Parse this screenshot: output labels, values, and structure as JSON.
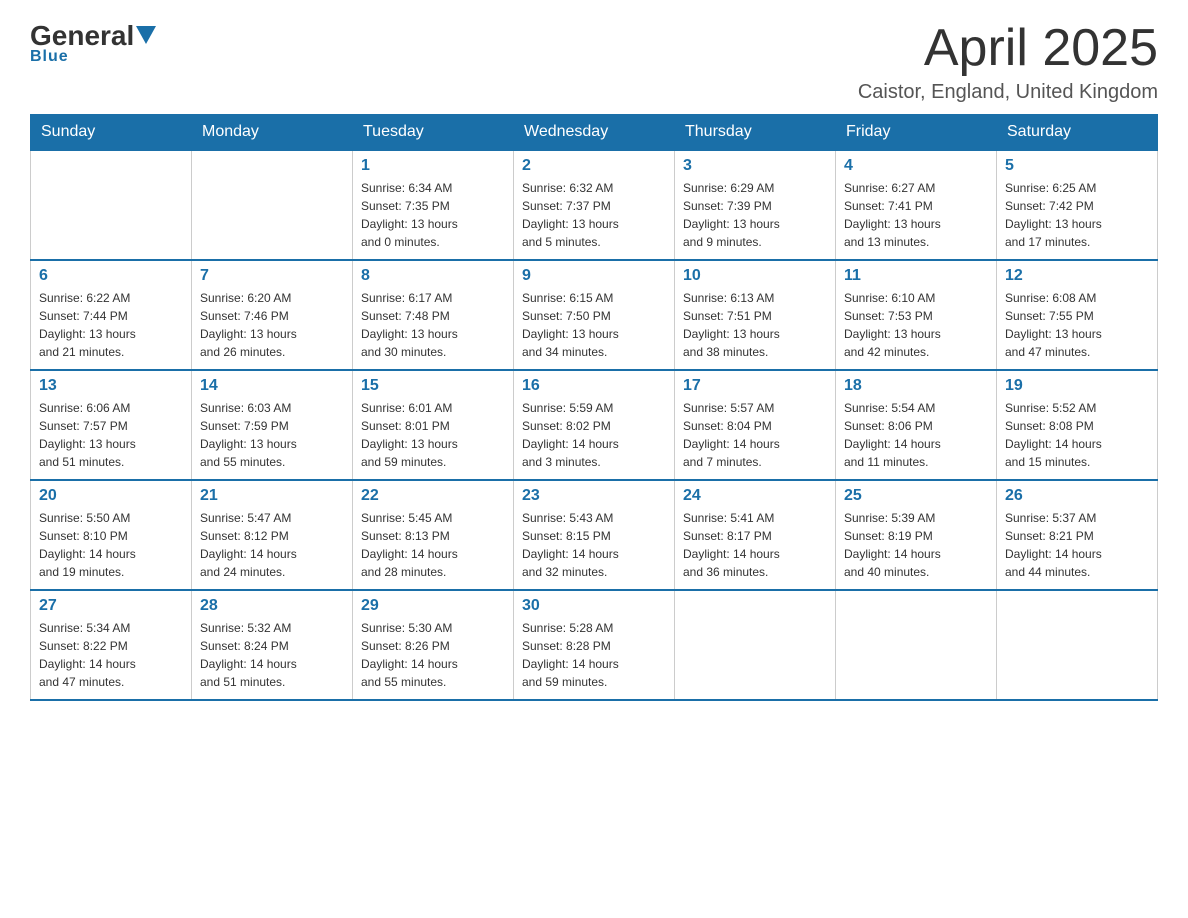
{
  "logo": {
    "general": "General",
    "blue": "Blue"
  },
  "header": {
    "title": "April 2025",
    "subtitle": "Caistor, England, United Kingdom"
  },
  "weekdays": [
    "Sunday",
    "Monday",
    "Tuesday",
    "Wednesday",
    "Thursday",
    "Friday",
    "Saturday"
  ],
  "weeks": [
    [
      {
        "day": "",
        "info": ""
      },
      {
        "day": "",
        "info": ""
      },
      {
        "day": "1",
        "info": "Sunrise: 6:34 AM\nSunset: 7:35 PM\nDaylight: 13 hours\nand 0 minutes."
      },
      {
        "day": "2",
        "info": "Sunrise: 6:32 AM\nSunset: 7:37 PM\nDaylight: 13 hours\nand 5 minutes."
      },
      {
        "day": "3",
        "info": "Sunrise: 6:29 AM\nSunset: 7:39 PM\nDaylight: 13 hours\nand 9 minutes."
      },
      {
        "day": "4",
        "info": "Sunrise: 6:27 AM\nSunset: 7:41 PM\nDaylight: 13 hours\nand 13 minutes."
      },
      {
        "day": "5",
        "info": "Sunrise: 6:25 AM\nSunset: 7:42 PM\nDaylight: 13 hours\nand 17 minutes."
      }
    ],
    [
      {
        "day": "6",
        "info": "Sunrise: 6:22 AM\nSunset: 7:44 PM\nDaylight: 13 hours\nand 21 minutes."
      },
      {
        "day": "7",
        "info": "Sunrise: 6:20 AM\nSunset: 7:46 PM\nDaylight: 13 hours\nand 26 minutes."
      },
      {
        "day": "8",
        "info": "Sunrise: 6:17 AM\nSunset: 7:48 PM\nDaylight: 13 hours\nand 30 minutes."
      },
      {
        "day": "9",
        "info": "Sunrise: 6:15 AM\nSunset: 7:50 PM\nDaylight: 13 hours\nand 34 minutes."
      },
      {
        "day": "10",
        "info": "Sunrise: 6:13 AM\nSunset: 7:51 PM\nDaylight: 13 hours\nand 38 minutes."
      },
      {
        "day": "11",
        "info": "Sunrise: 6:10 AM\nSunset: 7:53 PM\nDaylight: 13 hours\nand 42 minutes."
      },
      {
        "day": "12",
        "info": "Sunrise: 6:08 AM\nSunset: 7:55 PM\nDaylight: 13 hours\nand 47 minutes."
      }
    ],
    [
      {
        "day": "13",
        "info": "Sunrise: 6:06 AM\nSunset: 7:57 PM\nDaylight: 13 hours\nand 51 minutes."
      },
      {
        "day": "14",
        "info": "Sunrise: 6:03 AM\nSunset: 7:59 PM\nDaylight: 13 hours\nand 55 minutes."
      },
      {
        "day": "15",
        "info": "Sunrise: 6:01 AM\nSunset: 8:01 PM\nDaylight: 13 hours\nand 59 minutes."
      },
      {
        "day": "16",
        "info": "Sunrise: 5:59 AM\nSunset: 8:02 PM\nDaylight: 14 hours\nand 3 minutes."
      },
      {
        "day": "17",
        "info": "Sunrise: 5:57 AM\nSunset: 8:04 PM\nDaylight: 14 hours\nand 7 minutes."
      },
      {
        "day": "18",
        "info": "Sunrise: 5:54 AM\nSunset: 8:06 PM\nDaylight: 14 hours\nand 11 minutes."
      },
      {
        "day": "19",
        "info": "Sunrise: 5:52 AM\nSunset: 8:08 PM\nDaylight: 14 hours\nand 15 minutes."
      }
    ],
    [
      {
        "day": "20",
        "info": "Sunrise: 5:50 AM\nSunset: 8:10 PM\nDaylight: 14 hours\nand 19 minutes."
      },
      {
        "day": "21",
        "info": "Sunrise: 5:47 AM\nSunset: 8:12 PM\nDaylight: 14 hours\nand 24 minutes."
      },
      {
        "day": "22",
        "info": "Sunrise: 5:45 AM\nSunset: 8:13 PM\nDaylight: 14 hours\nand 28 minutes."
      },
      {
        "day": "23",
        "info": "Sunrise: 5:43 AM\nSunset: 8:15 PM\nDaylight: 14 hours\nand 32 minutes."
      },
      {
        "day": "24",
        "info": "Sunrise: 5:41 AM\nSunset: 8:17 PM\nDaylight: 14 hours\nand 36 minutes."
      },
      {
        "day": "25",
        "info": "Sunrise: 5:39 AM\nSunset: 8:19 PM\nDaylight: 14 hours\nand 40 minutes."
      },
      {
        "day": "26",
        "info": "Sunrise: 5:37 AM\nSunset: 8:21 PM\nDaylight: 14 hours\nand 44 minutes."
      }
    ],
    [
      {
        "day": "27",
        "info": "Sunrise: 5:34 AM\nSunset: 8:22 PM\nDaylight: 14 hours\nand 47 minutes."
      },
      {
        "day": "28",
        "info": "Sunrise: 5:32 AM\nSunset: 8:24 PM\nDaylight: 14 hours\nand 51 minutes."
      },
      {
        "day": "29",
        "info": "Sunrise: 5:30 AM\nSunset: 8:26 PM\nDaylight: 14 hours\nand 55 minutes."
      },
      {
        "day": "30",
        "info": "Sunrise: 5:28 AM\nSunset: 8:28 PM\nDaylight: 14 hours\nand 59 minutes."
      },
      {
        "day": "",
        "info": ""
      },
      {
        "day": "",
        "info": ""
      },
      {
        "day": "",
        "info": ""
      }
    ]
  ]
}
